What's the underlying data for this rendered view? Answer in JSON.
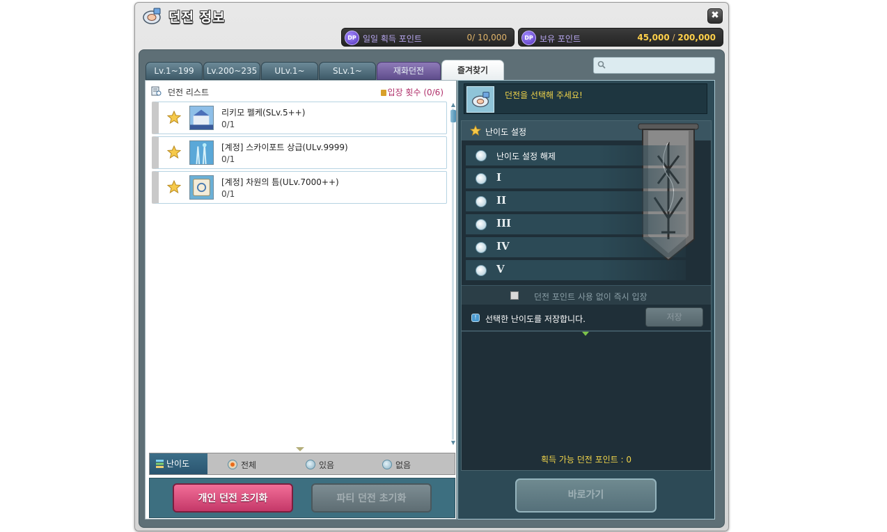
{
  "window": {
    "title": "던전 정보",
    "close_label": "✖"
  },
  "points": {
    "daily_label": "일일 획득 포인트",
    "daily_value": "0/  10,000",
    "owned_label": "보유 포인트",
    "owned_value": "45,000",
    "owned_separator": " / ",
    "owned_max": "200,000",
    "icon_text": "DP"
  },
  "tabs": [
    {
      "label": "Lv.1~199"
    },
    {
      "label": "Lv.200~235"
    },
    {
      "label": "ULv.1~"
    },
    {
      "label": "SLv.1~"
    },
    {
      "label": "재화던전"
    },
    {
      "label": "즐겨찾기"
    }
  ],
  "search": {
    "placeholder": ""
  },
  "list": {
    "title": "던전 리스트",
    "entry_count": "입장 횟수  (0/6)",
    "items": [
      {
        "name": "리키모 펠케(SLv.5++)",
        "progress": "0/1"
      },
      {
        "name": "[계정] 스카이포트 상급(ULv.9999)",
        "progress": "0/1"
      },
      {
        "name": "[계정] 차원의 틈(ULv.7000++)",
        "progress": "0/1"
      }
    ]
  },
  "filter": {
    "label": "난이도",
    "options": [
      {
        "label": "전체",
        "selected": true
      },
      {
        "label": "있음",
        "selected": false
      },
      {
        "label": "없음",
        "selected": false
      }
    ]
  },
  "buttons": {
    "personal_reset": "개인 던전 초기화",
    "party_reset": "파티 던전 초기화",
    "go": "바로가기",
    "save": "저장"
  },
  "detail": {
    "message": "던전을 선택해 주세요!",
    "difficulty_title": "난이도 설정",
    "difficulty_options": [
      "난이도 설정 해제",
      "I",
      "II",
      "III",
      "IV",
      "V"
    ],
    "instant_entry": "던전 포인트 사용 없이 즉시 입장",
    "save_text": "선택한 난이도를 저장합니다.",
    "obtainable": "획득 가능 던전 포인트 :  0"
  },
  "colors": {
    "accent_gold": "#f0d44a",
    "dp_purple": "#b7a6ee",
    "personal_reset_pink": "#e05585",
    "entry_count_red": "#b0306a"
  }
}
